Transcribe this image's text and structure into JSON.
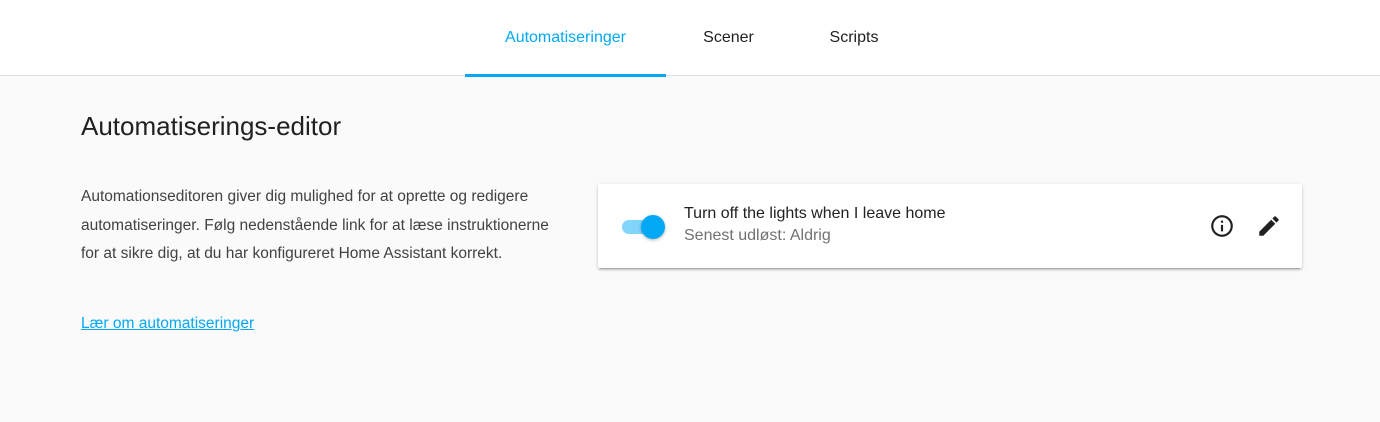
{
  "tabs": [
    {
      "label": "Automatiseringer",
      "active": true
    },
    {
      "label": "Scener",
      "active": false
    },
    {
      "label": "Scripts",
      "active": false
    }
  ],
  "page": {
    "title": "Automatiserings-editor",
    "intro": "Automationseditoren giver dig mulighed for at oprette og redigere automatiseringer. Følg nedenstående link for at læse instruktionerne for at sikre dig, at du har konfigureret Home Assistant korrekt.",
    "learn_link": "Lær om automatiseringer"
  },
  "automations": [
    {
      "name": "Turn off the lights when I leave home",
      "last_triggered": "Senest udløst: Aldrig",
      "enabled": true,
      "icons": [
        "info-icon",
        "pencil-icon"
      ]
    }
  ],
  "colors": {
    "accent": "#03a9f4",
    "toggle_track": "#81d4fa",
    "background": "#fafafa",
    "card": "#ffffff"
  }
}
